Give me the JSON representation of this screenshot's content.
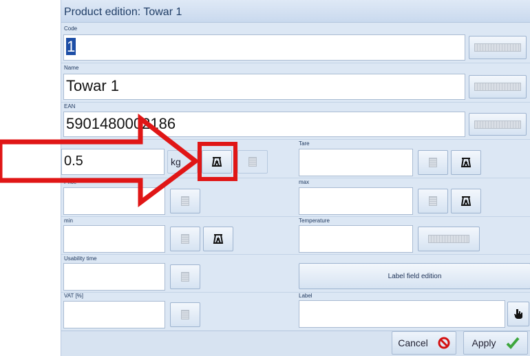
{
  "window": {
    "title": "Product edition: Towar 1"
  },
  "fields": {
    "code": {
      "label": "Code",
      "value": "1"
    },
    "name": {
      "label": "Name",
      "value": "Towar 1"
    },
    "ean": {
      "label": "EAN",
      "value": "5901480002186"
    },
    "weight": {
      "value": "0.5",
      "unit": "kg"
    },
    "tare": {
      "label": "Tare",
      "value": ""
    },
    "price": {
      "label": "Price",
      "value": ""
    },
    "max": {
      "label": "max",
      "value": ""
    },
    "min": {
      "label": "min",
      "value": ""
    },
    "temperature": {
      "label": "Temperature",
      "value": ""
    },
    "usability_time": {
      "label": "Usability time",
      "value": ""
    },
    "vat": {
      "label": "VAT [%]",
      "value": ""
    },
    "label": {
      "label": "Label",
      "value": ""
    }
  },
  "buttons": {
    "label_field_edition": "Label field edition",
    "cancel": "Cancel",
    "apply": "Apply"
  },
  "icons": {
    "keyboard": "keyboard-icon",
    "numpad": "numpad-icon",
    "scale": "scale-icon",
    "hand": "hand-pointer-icon",
    "cancel": "cancel-icon",
    "apply": "checkmark-icon"
  },
  "annotation": {
    "color": "#e01616"
  }
}
